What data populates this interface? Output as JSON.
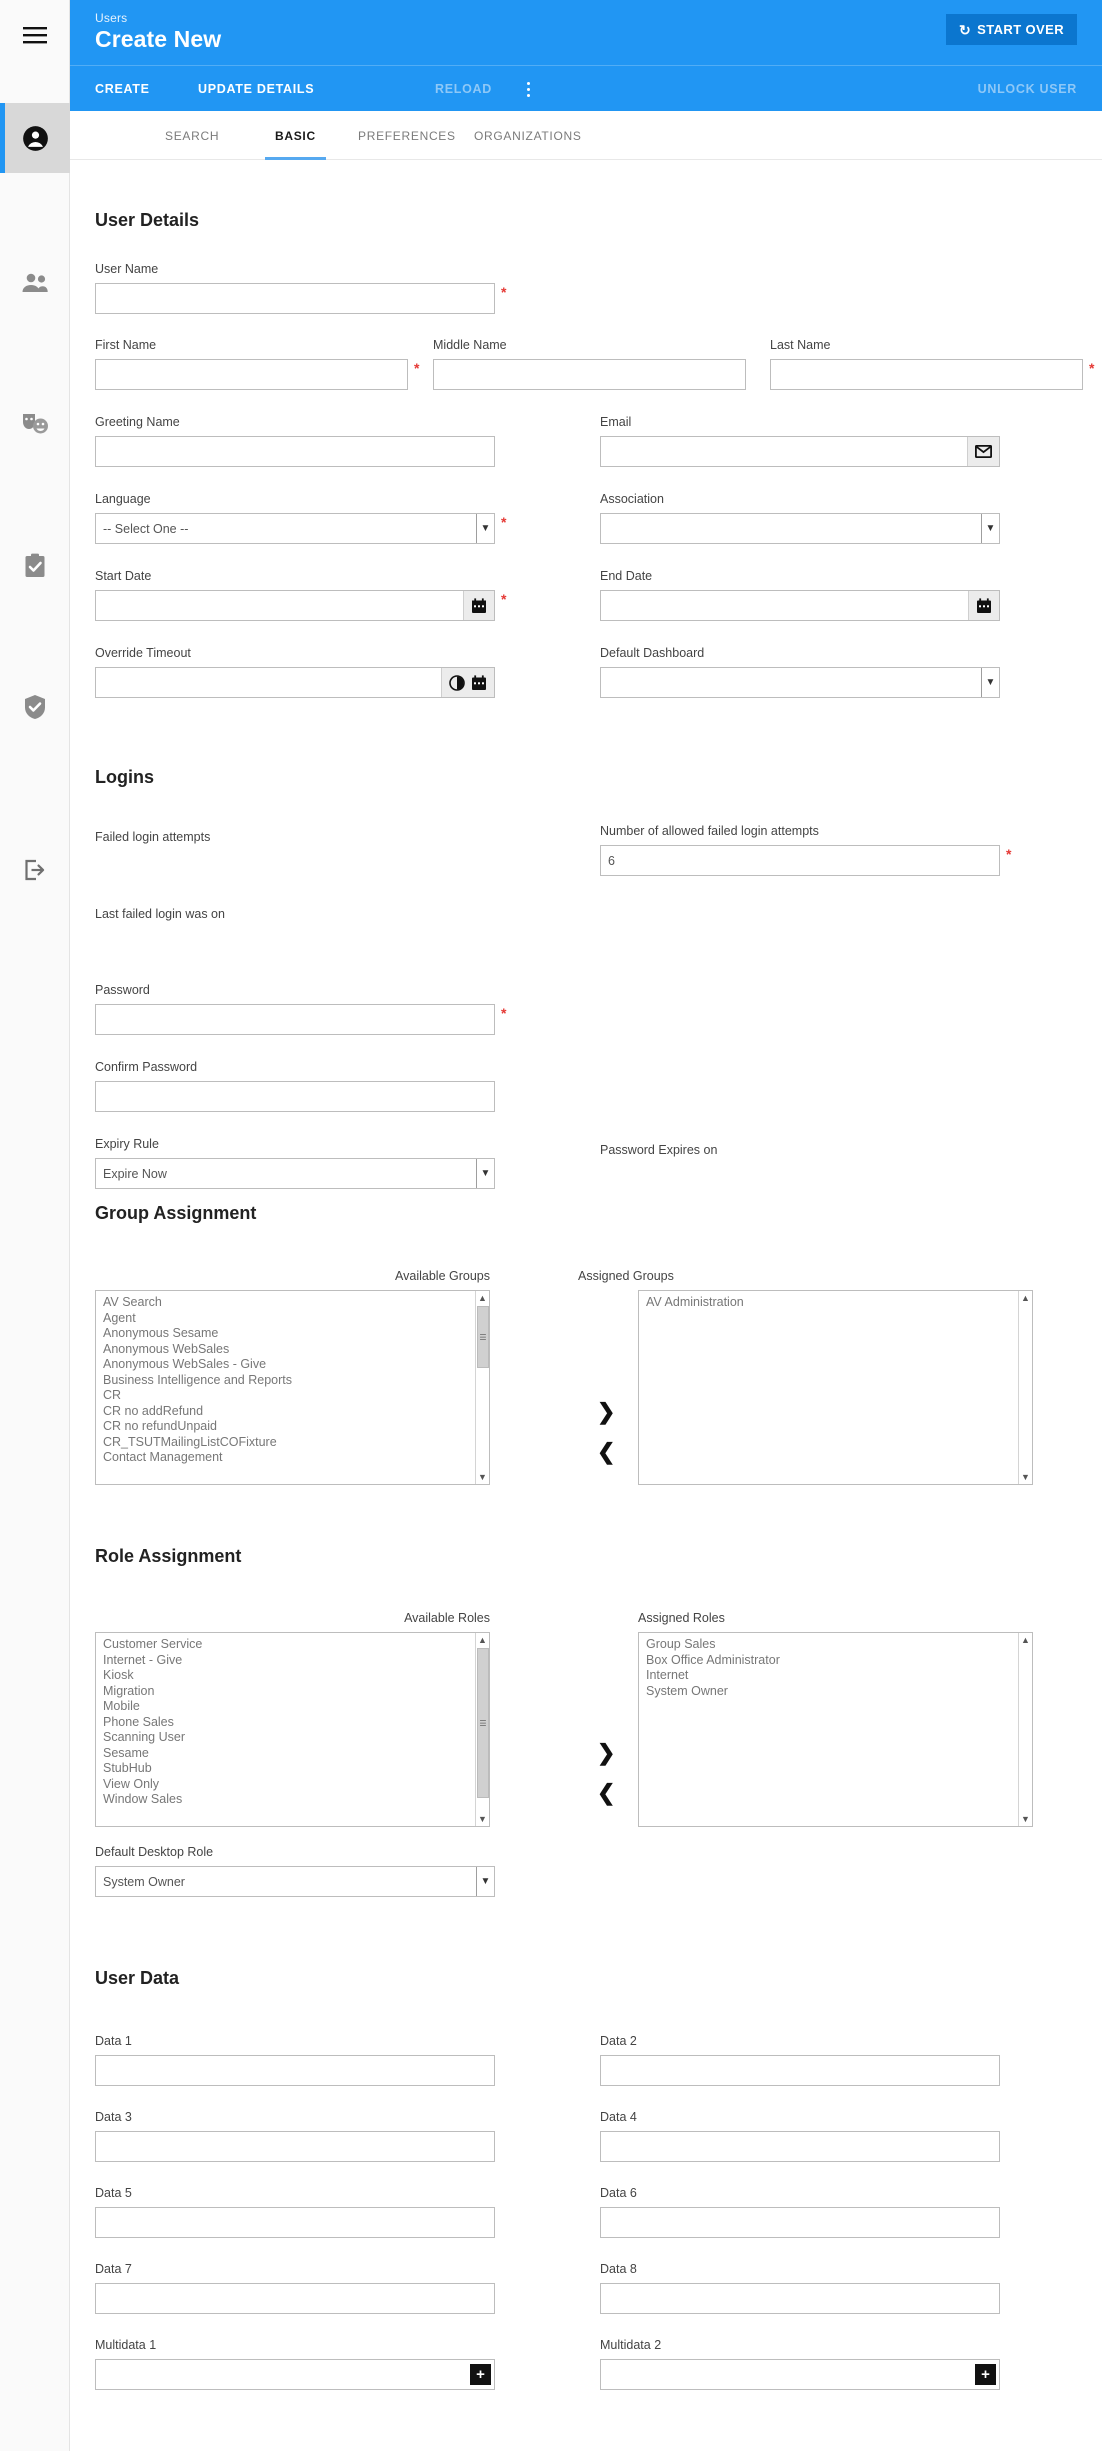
{
  "rail": {
    "items": [
      {
        "name": "menu-icon",
        "label": "Menu"
      },
      {
        "name": "account-icon",
        "label": "Users"
      },
      {
        "name": "people-icon",
        "label": "Customers"
      },
      {
        "name": "masks-icon",
        "label": "Events"
      },
      {
        "name": "clipboard-check-icon",
        "label": "Tasks"
      },
      {
        "name": "shield-check-icon",
        "label": "Security"
      },
      {
        "name": "logout-icon",
        "label": "Logout"
      }
    ]
  },
  "header": {
    "breadcrumb": "Users",
    "title": "Create New",
    "start_over_label": "START OVER",
    "start_over_icon": "refresh-icon"
  },
  "actionbar": {
    "create": "CREATE",
    "update_details": "UPDATE DETAILS",
    "reload": "RELOAD",
    "overflow_icon": "kebab-menu-icon",
    "unlock_user": "UNLOCK USER"
  },
  "tabs": [
    {
      "label": "SEARCH",
      "selected": false
    },
    {
      "label": "BASIC",
      "selected": true
    },
    {
      "label": "PREFERENCES",
      "selected": false
    },
    {
      "label": "ORGANIZATIONS",
      "selected": false
    }
  ],
  "user_details": {
    "heading": "User Details",
    "user_name": {
      "label": "User Name",
      "value": "",
      "required": true
    },
    "first_name": {
      "label": "First Name",
      "value": "",
      "required": true
    },
    "middle_name": {
      "label": "Middle Name",
      "value": "",
      "required": false
    },
    "last_name": {
      "label": "Last Name",
      "value": "",
      "required": true
    },
    "greeting_name": {
      "label": "Greeting Name",
      "value": "",
      "required": false
    },
    "email": {
      "label": "Email",
      "value": "",
      "required": false,
      "addon_icon": "envelope-icon"
    },
    "language": {
      "label": "Language",
      "value": "-- Select One --",
      "required": true
    },
    "association": {
      "label": "Association",
      "value": "",
      "required": false
    },
    "start_date": {
      "label": "Start Date",
      "value": "",
      "required": true,
      "addon_icon": "calendar-icon"
    },
    "end_date": {
      "label": "End Date",
      "value": "",
      "required": false,
      "addon_icon": "calendar-icon"
    },
    "override_timeout": {
      "label": "Override Timeout",
      "value": "",
      "required": false,
      "addon_icons": [
        "clock-icon",
        "calendar-icon"
      ]
    },
    "default_dashboard": {
      "label": "Default Dashboard",
      "value": "",
      "required": false
    }
  },
  "logins": {
    "heading": "Logins",
    "failed_login_attempts": {
      "label": "Failed login attempts",
      "value": ""
    },
    "allowed_failed_attempts": {
      "label": "Number of allowed failed login attempts",
      "value": "6",
      "required": true
    },
    "last_failed_login": {
      "label": "Last failed login was on",
      "value": ""
    },
    "password": {
      "label": "Password",
      "value": "",
      "required": true
    },
    "confirm_password": {
      "label": "Confirm Password",
      "value": "",
      "required": false
    },
    "expiry_rule": {
      "label": "Expiry Rule",
      "value": "Expire Now"
    },
    "password_expires_on": {
      "label": "Password Expires on",
      "value": ""
    }
  },
  "group_assignment": {
    "heading": "Group Assignment",
    "available_label": "Available Groups",
    "assigned_label": "Assigned Groups",
    "available": [
      "AV Search",
      "Agent",
      "Anonymous Sesame",
      "Anonymous WebSales",
      "Anonymous WebSales - Give",
      "Business Intelligence and Reports",
      "CR",
      "CR no addRefund",
      "CR no refundUnpaid",
      "CR_TSUTMailingListCOFixture",
      "Contact Management"
    ],
    "assigned": [
      "AV Administration"
    ],
    "add_icon": "chevron-right-icon",
    "remove_icon": "chevron-left-icon"
  },
  "role_assignment": {
    "heading": "Role Assignment",
    "available_label": "Available Roles",
    "assigned_label": "Assigned Roles",
    "available": [
      "Customer Service",
      "Internet - Give",
      "Kiosk",
      "Migration",
      "Mobile",
      "Phone Sales",
      "Scanning User",
      "Sesame",
      "StubHub",
      "View Only",
      "Window Sales"
    ],
    "assigned": [
      "Group Sales",
      "Box Office Administrator",
      "Internet",
      "System Owner"
    ],
    "add_icon": "chevron-right-icon",
    "remove_icon": "chevron-left-icon",
    "default_desktop_role": {
      "label": "Default Desktop Role",
      "value": "System Owner"
    }
  },
  "user_data": {
    "heading": "User Data",
    "fields": [
      {
        "label": "Data 1",
        "value": ""
      },
      {
        "label": "Data 2",
        "value": ""
      },
      {
        "label": "Data 3",
        "value": ""
      },
      {
        "label": "Data 4",
        "value": ""
      },
      {
        "label": "Data 5",
        "value": ""
      },
      {
        "label": "Data 6",
        "value": ""
      },
      {
        "label": "Data 7",
        "value": ""
      },
      {
        "label": "Data 8",
        "value": ""
      }
    ],
    "multidata": [
      {
        "label": "Multidata 1",
        "value": "",
        "add_icon": "plus-icon"
      },
      {
        "label": "Multidata 2",
        "value": "",
        "add_icon": "plus-icon"
      }
    ]
  },
  "colors": {
    "brand_blue": "#2196f3",
    "button_blue": "#0b76cf",
    "tab_underline": "#56a9f0",
    "required_red": "#e53935"
  }
}
